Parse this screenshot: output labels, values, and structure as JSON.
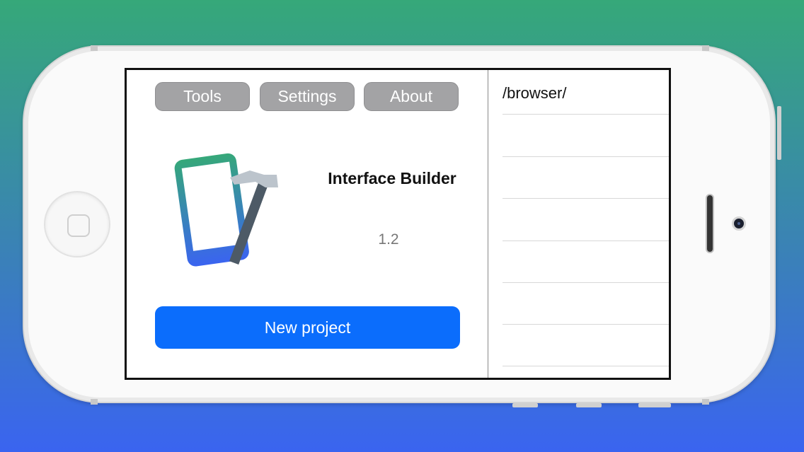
{
  "toolbar": {
    "tools_label": "Tools",
    "settings_label": "Settings",
    "about_label": "About"
  },
  "app": {
    "name": "Interface Builder",
    "version": "1.2",
    "icon": "phone-hammer-icon"
  },
  "actions": {
    "new_project_label": "New project"
  },
  "browser": {
    "path": "/browser/",
    "rows": [
      "",
      "",
      "",
      "",
      "",
      "",
      ""
    ]
  },
  "colors": {
    "accent": "#0b6dfc",
    "tab_button": "#a3a3a5",
    "background_top": "#36a879",
    "background_bottom": "#3a64f0"
  }
}
